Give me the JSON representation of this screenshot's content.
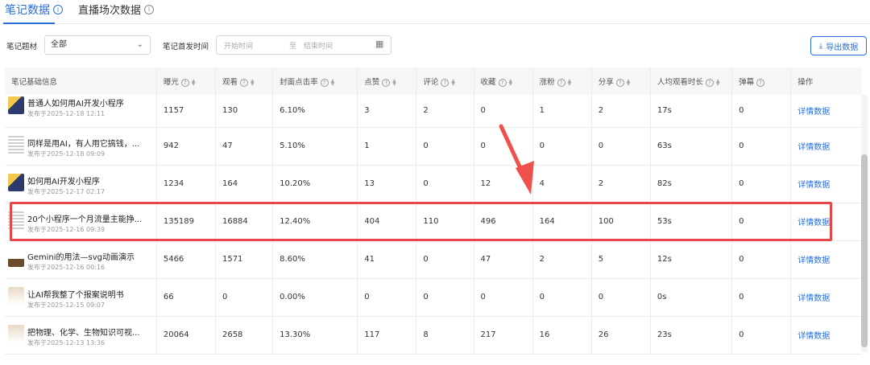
{
  "tabs": [
    {
      "label": "笔记数据",
      "active": true
    },
    {
      "label": "直播场次数据",
      "active": false
    }
  ],
  "filters": {
    "topic_label": "笔记题材",
    "topic_value": "全部",
    "date_label": "笔记首发时间",
    "start_placeholder": "开始时间",
    "separator": "至",
    "end_placeholder": "结束时间"
  },
  "export_label": "导出数据",
  "table": {
    "headers": [
      "笔记基础信息",
      "曝光",
      "观看",
      "封面点击率",
      "点赞",
      "评论",
      "收藏",
      "涨粉",
      "分享",
      "人均观看时长",
      "弹幕",
      "操作"
    ],
    "rows": [
      {
        "title": "普通人如何用AI开发小程序",
        "date": "发布于2025-12-18 12:11",
        "thumb": "a",
        "values": [
          "1157",
          "130",
          "6.10%",
          "3",
          "2",
          "0",
          "1",
          "2",
          "17s",
          "0"
        ],
        "action": "详情数据"
      },
      {
        "title": "同样是用AI，有人用它搞钱，...",
        "date": "发布于2025-12-18 09:09",
        "thumb": "b",
        "values": [
          "942",
          "47",
          "5.10%",
          "1",
          "0",
          "0",
          "0",
          "0",
          "63s",
          "0"
        ],
        "action": "详情数据"
      },
      {
        "title": "如何用AI开发小程序",
        "date": "发布于2025-12-17 02:17",
        "thumb": "a",
        "values": [
          "1234",
          "164",
          "10.20%",
          "13",
          "0",
          "12",
          "4",
          "2",
          "82s",
          "0"
        ],
        "action": "详情数据"
      },
      {
        "title": "20个小程序一个月流量主能挣...",
        "date": "发布于2025-12-16 09:39",
        "thumb": "b",
        "values": [
          "135189",
          "16884",
          "12.40%",
          "404",
          "110",
          "496",
          "164",
          "100",
          "53s",
          "0"
        ],
        "action": "详情数据"
      },
      {
        "title": "Gemini的用法—svg动画演示",
        "date": "发布于2025-12-16 00:16",
        "thumb": "c",
        "values": [
          "5466",
          "1571",
          "8.60%",
          "41",
          "0",
          "47",
          "2",
          "5",
          "12s",
          "0"
        ],
        "action": "详情数据"
      },
      {
        "title": "让AI帮我整了个报案说明书",
        "date": "发布于2025-12-15 09:07",
        "thumb": "d",
        "values": [
          "66",
          "0",
          "0.00%",
          "0",
          "0",
          "0",
          "0",
          "0",
          "0s",
          "0"
        ],
        "action": "详情数据"
      },
      {
        "title": "把物理、化学、生物知识可视...",
        "date": "发布于2025-12-13 13:36",
        "thumb": "d",
        "values": [
          "20064",
          "2658",
          "13.30%",
          "117",
          "8",
          "217",
          "16",
          "26",
          "23s",
          "0"
        ],
        "action": "详情数据"
      }
    ]
  },
  "colors": {
    "accent": "#2a6fd8",
    "highlight": "#e8474a"
  }
}
